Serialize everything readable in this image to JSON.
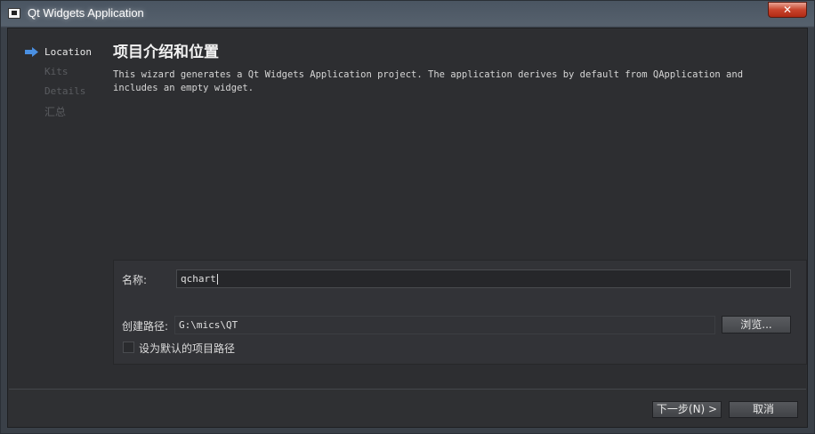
{
  "window": {
    "title": "Qt Widgets Application",
    "close_label": "✕"
  },
  "sidebar": {
    "steps": [
      {
        "label": "Location",
        "active": true
      },
      {
        "label": "Kits",
        "active": false
      },
      {
        "label": "Details",
        "active": false
      },
      {
        "label": "汇总",
        "active": false
      }
    ]
  },
  "main": {
    "title": "项目介绍和位置",
    "description": "This wizard generates a Qt Widgets Application project. The application derives by default from QApplication and includes an empty widget."
  },
  "form": {
    "name_label": "名称:",
    "name_value": "qchart",
    "path_label": "创建路径:",
    "path_value": "G:\\mics\\QT",
    "browse_label": "浏览...",
    "default_path_label": "设为默认的项目路径"
  },
  "footer": {
    "next_label": "下一步(N) >",
    "cancel_label": "取消"
  },
  "colors": {
    "arrow": "#4a90e2",
    "background": "#2d2e31"
  }
}
